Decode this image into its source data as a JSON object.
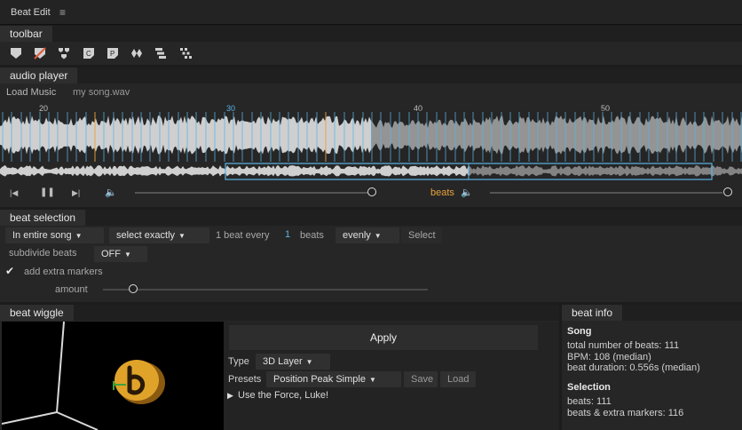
{
  "window": {
    "title": "Beat Edit",
    "menu_icon": "hamburger-icon"
  },
  "toolbar": {
    "tab": "toolbar",
    "tools": [
      "heart-marker-icon",
      "no-marker-icon",
      "merge-icon",
      "comment-c-icon",
      "comment-p-icon",
      "diamond-icon",
      "layers-icon",
      "grid-dots-icon"
    ]
  },
  "audio_player": {
    "tab": "audio player",
    "load_button": "Load Music",
    "file_name": "my song.wav",
    "ruler": [
      "20",
      "30",
      "40",
      "50"
    ],
    "beats_label": "beats",
    "colors": {
      "accent": "#5bb4e6",
      "beats": "#e8a23c"
    }
  },
  "beat_selection": {
    "tab": "beat selection",
    "scope": "In entire song",
    "mode": "select exactly",
    "every_prefix": "1 beat every",
    "every_value": "1",
    "every_suffix": "beats",
    "distribution": "evenly",
    "select_button": "Select",
    "subdivide_label": "subdivide beats",
    "subdivide_value": "OFF",
    "extra_markers_label": "add extra markers",
    "extra_markers_checked": true,
    "amount_label": "amount"
  },
  "beat_wiggle": {
    "tab": "beat wiggle",
    "apply_button": "Apply",
    "type_label": "Type",
    "type_value": "3D Layer",
    "presets_label": "Presets",
    "preset_value": "Position Peak Simple",
    "save_button": "Save",
    "load_button": "Load",
    "expression": "Use the Force, Luke!"
  },
  "beat_info": {
    "tab": "beat info",
    "song_heading": "Song",
    "total_beats": "total number of beats: 111",
    "bpm": "BPM: 108 (median)",
    "duration": "beat duration: 0.556s (median)",
    "selection_heading": "Selection",
    "sel_beats": "beats: 111",
    "sel_beats_markers": "beats & extra markers: 116"
  }
}
